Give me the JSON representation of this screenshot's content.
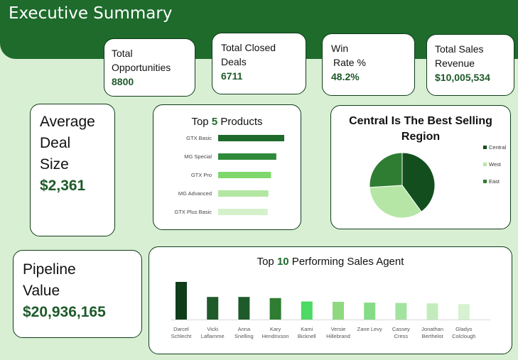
{
  "header": {
    "title": "Executive Summary"
  },
  "kpis": {
    "opportunities": {
      "label1": "Total",
      "label2": "Opportunities",
      "value": "8800"
    },
    "closed": {
      "label1": "Total Closed",
      "label2": "Deals",
      "value": "6711"
    },
    "winrate": {
      "label1": "Win",
      "label2": "Rate %",
      "value": "48.2%"
    },
    "revenue": {
      "label1": "Total Sales",
      "label2": "Revenue",
      "value": "$10,005,534"
    }
  },
  "avg_deal": {
    "label1": "Average",
    "label2": "Deal",
    "label3": "Size",
    "value": "$2,361"
  },
  "pipeline": {
    "label1": "Pipeline",
    "label2": "Value",
    "value": "$20,936,165"
  },
  "products_chart": {
    "title_pre": "Top ",
    "title_num": "5",
    "title_post": " Products"
  },
  "region_chart": {
    "title_line1": "Central Is The  Best Selling",
    "title_line2": "Region"
  },
  "agents_chart": {
    "title_pre": "Top ",
    "title_num": "10",
    "title_post": " Performing Sales Agent"
  },
  "chart_data": [
    {
      "type": "bar",
      "orientation": "horizontal",
      "title": "Top 5 Products",
      "categories": [
        "GTX Basic",
        "MG Special",
        "GTX Pro",
        "MG Advanced",
        "GTX Plus Basic"
      ],
      "values": [
        100,
        88,
        80,
        76,
        75
      ],
      "colors": [
        "#1e6b2c",
        "#2f8a3a",
        "#7fd86b",
        "#b3e6a3",
        "#d4f1cc"
      ]
    },
    {
      "type": "pie",
      "title": "Central Is The  Best Selling Region",
      "categories": [
        "Central",
        "West",
        "East"
      ],
      "values": [
        40,
        34,
        26
      ],
      "colors": [
        "#134f1e",
        "#b6e6a6",
        "#2e7d32"
      ],
      "legend": "right"
    },
    {
      "type": "bar",
      "title": "Top 10 Performing Sales Agent",
      "categories": [
        [
          "Darcel",
          "Schlecht"
        ],
        [
          "Vicki",
          "Laflamme"
        ],
        [
          "Anna",
          "Snelling"
        ],
        [
          "Kary",
          "Hendrixson"
        ],
        [
          "Kami",
          "Bicknell"
        ],
        [
          "Versie",
          "Hillebrand"
        ],
        [
          "Zane Levy",
          ""
        ],
        [
          "Cassey",
          "Cress"
        ],
        [
          "Jonathan",
          "Berthelot"
        ],
        [
          "Gladys",
          "Colclough"
        ]
      ],
      "values": [
        100,
        60,
        60,
        57,
        48,
        47,
        45,
        44,
        43,
        41
      ],
      "colors": [
        "#0f3d1a",
        "#1e5a2a",
        "#1e5a2a",
        "#2e7d32",
        "#4cd964",
        "#8ed97f",
        "#86dc86",
        "#a3e3a0",
        "#c3ecbd",
        "#d6f2d0"
      ]
    }
  ]
}
